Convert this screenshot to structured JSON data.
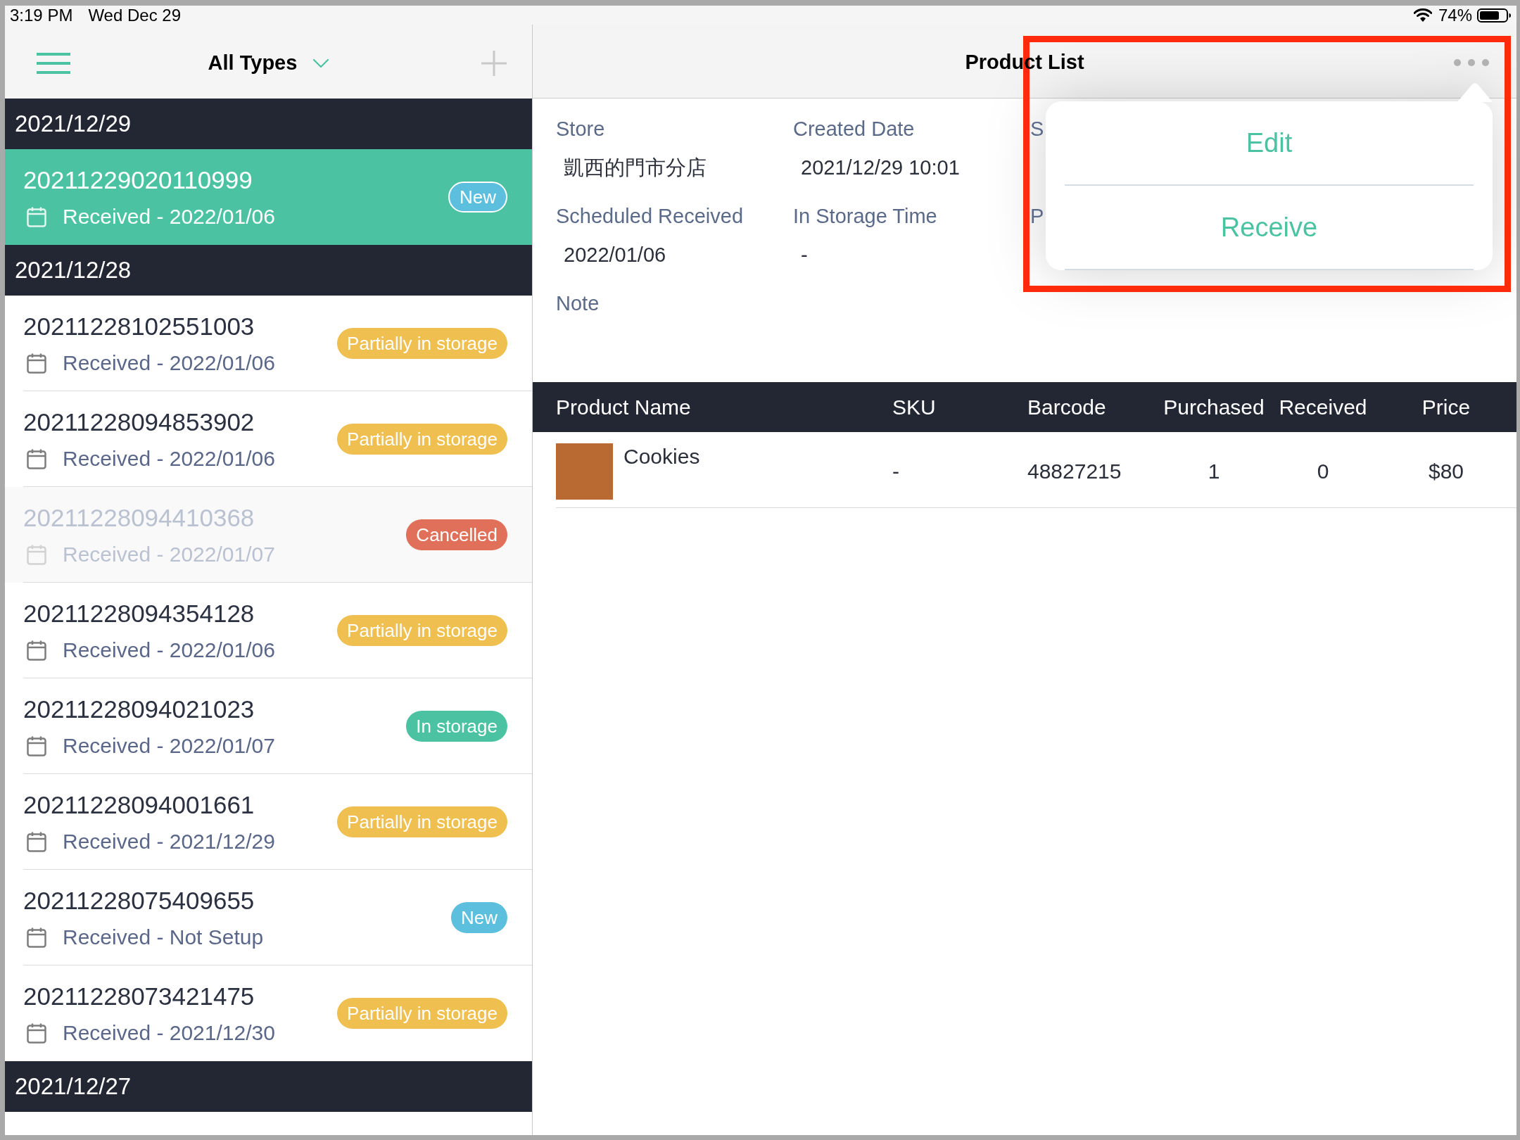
{
  "status_bar": {
    "time": "3:19 PM",
    "date": "Wed Dec 29",
    "battery": "74%"
  },
  "list_pane": {
    "title": "All Types",
    "groups": [
      {
        "date": "2021/12/29",
        "orders": [
          {
            "number": "20211229020110999",
            "received": "Received - 2022/01/06",
            "status": "New",
            "color": "#5bbfdd",
            "selected": true,
            "disabled": false
          }
        ]
      },
      {
        "date": "2021/12/28",
        "orders": [
          {
            "number": "20211228102551003",
            "received": "Received - 2022/01/06",
            "status": "Partially in storage",
            "color": "#efbf4f",
            "selected": false,
            "disabled": false
          },
          {
            "number": "20211228094853902",
            "received": "Received - 2022/01/06",
            "status": "Partially in storage",
            "color": "#efbf4f",
            "selected": false,
            "disabled": false
          },
          {
            "number": "20211228094410368",
            "received": "Received - 2022/01/07",
            "status": "Cancelled",
            "color": "#e0705a",
            "selected": false,
            "disabled": true
          },
          {
            "number": "20211228094354128",
            "received": "Received - 2022/01/06",
            "status": "Partially in storage",
            "color": "#efbf4f",
            "selected": false,
            "disabled": false
          },
          {
            "number": "20211228094021023",
            "received": "Received - 2022/01/07",
            "status": "In storage",
            "color": "#4bc3a2",
            "selected": false,
            "disabled": false
          },
          {
            "number": "20211228094001661",
            "received": "Received - 2021/12/29",
            "status": "Partially in storage",
            "color": "#efbf4f",
            "selected": false,
            "disabled": false
          },
          {
            "number": "20211228075409655",
            "received": "Received - Not Setup",
            "status": "New",
            "color": "#5bbfdd",
            "selected": false,
            "disabled": false
          },
          {
            "number": "20211228073421475",
            "received": "Received - 2021/12/30",
            "status": "Partially in storage",
            "color": "#efbf4f",
            "selected": false,
            "disabled": false
          }
        ]
      },
      {
        "date": "2021/12/27"
      }
    ]
  },
  "detail_pane": {
    "title": "Product List",
    "fields": [
      {
        "label": "Store",
        "value": "凱西的門市分店"
      },
      {
        "label": "Created Date",
        "value": "2021/12/29 10:01"
      },
      {
        "label": "S"
      },
      {
        "label": "Scheduled Received",
        "value": "2022/01/06"
      },
      {
        "label": "In Storage Time",
        "value": "-"
      },
      {
        "label": "P"
      },
      {
        "label": "Note"
      }
    ],
    "menu": {
      "highlighted": true,
      "items": [
        {
          "label": "Edit"
        },
        {
          "label": "Receive"
        }
      ]
    },
    "table": {
      "columns": [
        "Product Name",
        "SKU",
        "Barcode",
        "Purchased",
        "Received",
        "Price"
      ],
      "rows": [
        {
          "cells": [
            "Cookies",
            "-",
            "48827215",
            "1",
            "0",
            "$80"
          ]
        }
      ]
    }
  }
}
